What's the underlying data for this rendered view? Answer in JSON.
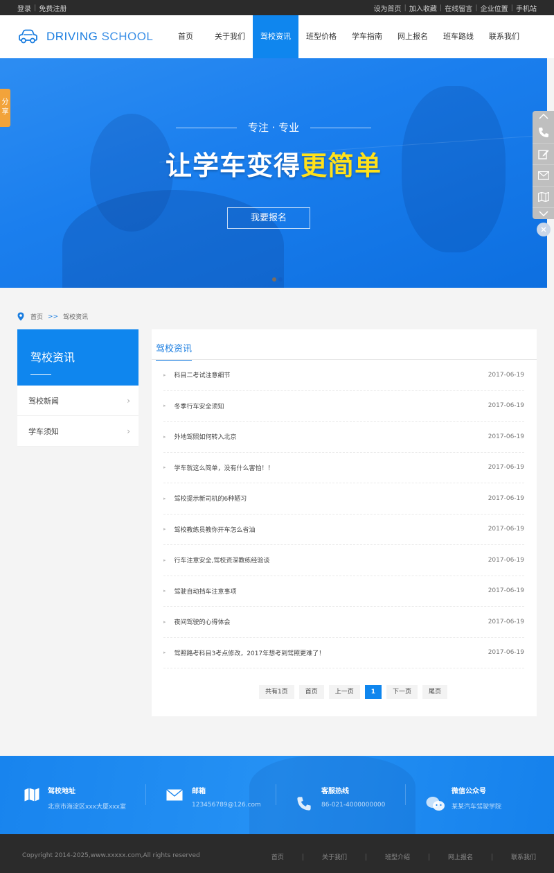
{
  "topbar": {
    "left": [
      "登录",
      "免费注册"
    ],
    "right": [
      "设为首页",
      "加入收藏",
      "在线留言",
      "企业位置",
      "手机站"
    ]
  },
  "logo": {
    "main": "DRIVING",
    "thin": "SCHOOL"
  },
  "nav": [
    "首页",
    "关于我们",
    "驾校资讯",
    "班型价格",
    "学车指南",
    "网上报名",
    "班车路线",
    "联系我们"
  ],
  "banner": {
    "motto": "专注 · 专业",
    "headline_pre": "让学车变得",
    "headline_hl": "更简单",
    "cta": "我要报名"
  },
  "share": "分享",
  "breadcrumb": {
    "home": "首页",
    "arrow": ">>",
    "current": "驾校资讯"
  },
  "sidebar": {
    "title": "驾校资讯",
    "items": [
      "驾校新闻",
      "学车须知"
    ]
  },
  "main": {
    "tab": "驾校资讯",
    "articles": [
      {
        "title": "科目二考试注意细节",
        "date": "2017-06-19"
      },
      {
        "title": "冬季行车安全须知",
        "date": "2017-06-19"
      },
      {
        "title": "外地驾照如何转入北京",
        "date": "2017-06-19"
      },
      {
        "title": "学车就这么简单，没有什么害怕！！",
        "date": "2017-06-19"
      },
      {
        "title": "驾校提示新司机的6种陋习",
        "date": "2017-06-19"
      },
      {
        "title": "驾校教练员教你开车怎么省油",
        "date": "2017-06-19"
      },
      {
        "title": "行车注意安全,驾校资深教练经验谈",
        "date": "2017-06-19"
      },
      {
        "title": "驾驶自动挡车注意事项",
        "date": "2017-06-19"
      },
      {
        "title": "夜间驾驶的心得体会",
        "date": "2017-06-19"
      },
      {
        "title": "驾照路考科目3考点修改，2017年想考到驾照更难了！",
        "date": "2017-06-19"
      }
    ],
    "pager": {
      "total": "共有1页",
      "first": "首页",
      "prev": "上一页",
      "current": "1",
      "next": "下一页",
      "last": "尾页"
    }
  },
  "footer": {
    "info": [
      {
        "title": "驾校地址",
        "value": "北京市海淀区xxx大厦xxx室"
      },
      {
        "title": "邮箱",
        "value": "123456789@126.com"
      },
      {
        "title": "客服热线",
        "value": "86-021-4000000000"
      },
      {
        "title": "微信公众号",
        "value": "某某汽车驾驶学院"
      }
    ],
    "copyright": "Copyright 2014-2025,www.xxxxx.com,All rights reserved",
    "nav": [
      "首页",
      "关于我们",
      "班型介绍",
      "网上报名",
      "联系我们"
    ]
  },
  "colors": {
    "primary": "#0f86ee",
    "highlight": "#ffe11a",
    "share": "#f2a33a",
    "dark": "#2b2b2b"
  }
}
